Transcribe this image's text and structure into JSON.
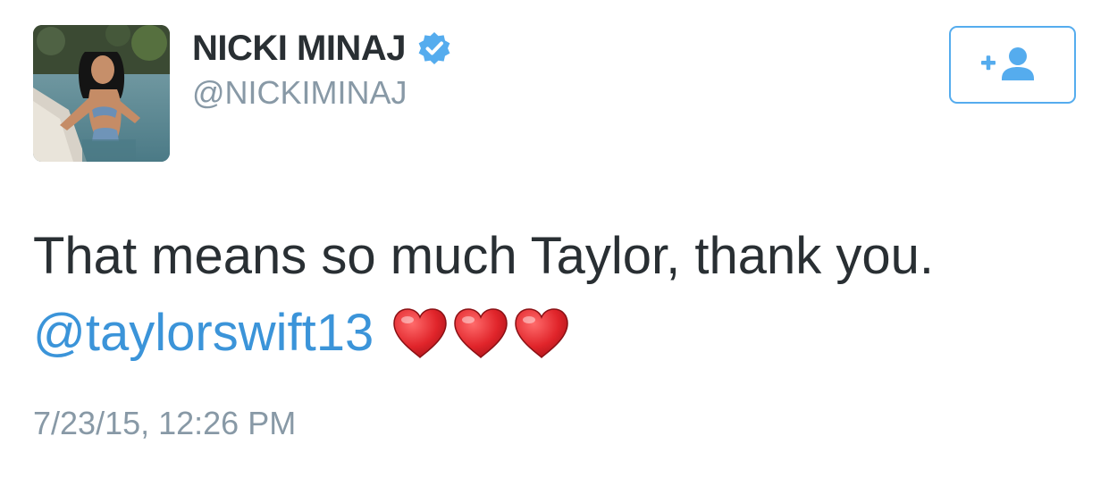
{
  "user": {
    "display_name": "NICKI MINAJ",
    "handle": "@NICKIMINAJ",
    "verified": true,
    "avatar_icon": "profile-photo"
  },
  "follow_button": {
    "icon": "add-user-icon",
    "color": "#55acee"
  },
  "tweet": {
    "text": "That means so much Taylor, thank you.",
    "mention": "@taylorswift13",
    "emoji": [
      "heart",
      "heart",
      "heart"
    ],
    "timestamp": "7/23/15, 12:26 PM"
  },
  "colors": {
    "text": "#292f33",
    "secondary": "#8899a6",
    "link": "#3b94d9",
    "accent": "#55acee",
    "heart": "#d9262c"
  }
}
